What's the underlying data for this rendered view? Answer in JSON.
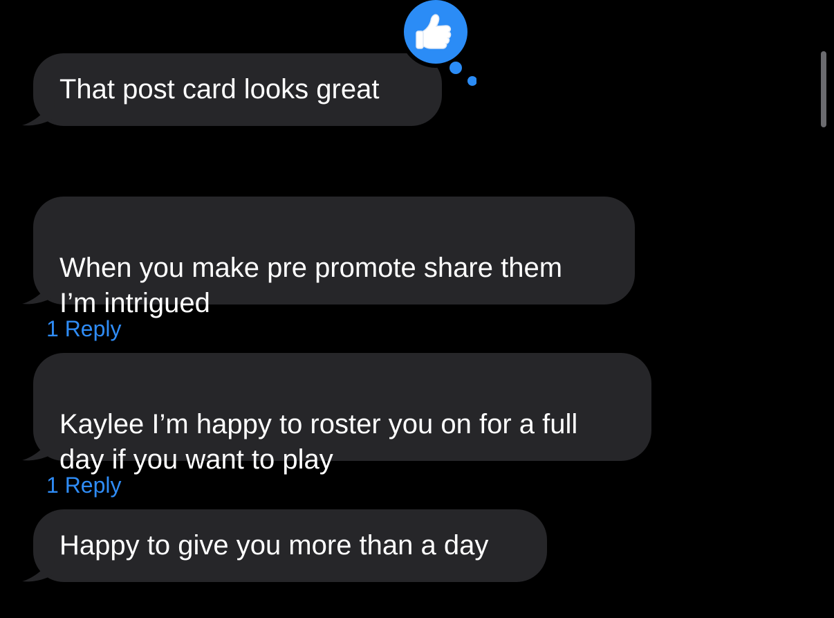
{
  "messages": [
    {
      "text": "That post card looks great",
      "reaction": "thumbs-up"
    },
    {
      "text": "When you make pre promote share them\nI’m intrigued",
      "replies": "1 Reply"
    },
    {
      "text": "Kaylee I’m happy to roster you on for a full\nday if you want to play",
      "replies": "1 Reply"
    },
    {
      "text": "Happy to give you more than a day"
    }
  ],
  "colors": {
    "background": "#000000",
    "bubble": "#262629",
    "accent": "#2f8cf6",
    "text": "#ffffff"
  },
  "icons": {
    "reaction": "thumbs-up-icon"
  }
}
